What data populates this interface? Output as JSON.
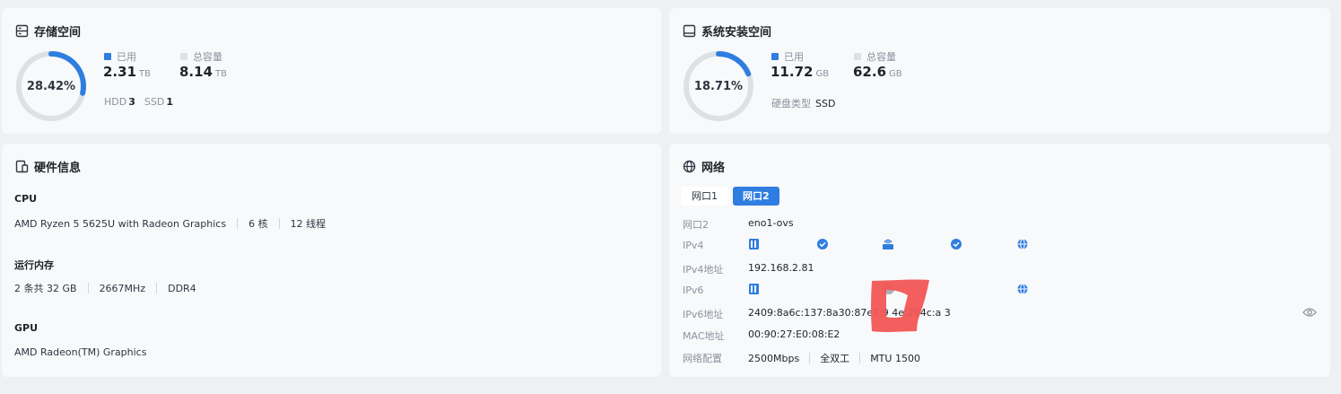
{
  "storage": {
    "title": "存储空间",
    "percent_label": "28.42%",
    "percent": 28.42,
    "legend_used": "已用",
    "legend_total": "总容量",
    "used_value": "2.31",
    "used_unit": "TB",
    "total_value": "8.14",
    "total_unit": "TB",
    "hdd_label": "HDD",
    "hdd_count": "3",
    "ssd_label": "SSD",
    "ssd_count": "1"
  },
  "system": {
    "title": "系统安装空间",
    "percent_label": "18.71%",
    "percent": 18.71,
    "legend_used": "已用",
    "legend_total": "总容量",
    "used_value": "11.72",
    "used_unit": "GB",
    "total_value": "62.6",
    "total_unit": "GB",
    "disk_type_label": "硬盘类型",
    "disk_type_value": "SSD"
  },
  "hardware": {
    "title": "硬件信息",
    "cpu_label": "CPU",
    "cpu_model": "AMD Ryzen 5 5625U with Radeon Graphics",
    "cpu_cores": "6 核",
    "cpu_threads": "12 线程",
    "mem_label": "运行内存",
    "mem_size": "2 条共 32 GB",
    "mem_speed": "2667MHz",
    "mem_type": "DDR4",
    "gpu_label": "GPU",
    "gpu_model": "AMD Radeon(TM) Graphics"
  },
  "network": {
    "title": "网络",
    "tabs": [
      "网口1",
      "网口2"
    ],
    "active_tab": 1,
    "port_label": "网口2",
    "port_value": "eno1-ovs",
    "ipv4_label": "IPv4",
    "ipv4_addr_label": "IPv4地址",
    "ipv4_addr": "192.168.2.81",
    "ipv6_label": "IPv6",
    "ipv6_addr_label": "IPv6地址",
    "ipv6_addr": "2409:8a6c:137:8a30:87e7:9 4e:294c:a 3",
    "mac_label": "MAC地址",
    "mac": "00:90:27:E0:08:E2",
    "config_label": "网络配置",
    "speed": "2500Mbps",
    "duplex": "全双工",
    "mtu": "MTU 1500"
  },
  "colors": {
    "accent": "#2f7de0",
    "track": "#dde1e6",
    "annotation": "#f25555"
  }
}
